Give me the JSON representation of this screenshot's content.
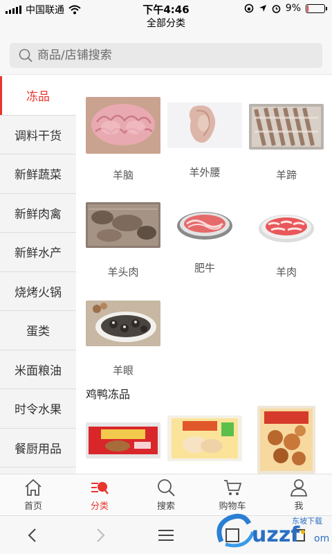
{
  "status": {
    "carrier": "中国联通",
    "time": "下午4:46",
    "battery": "9%",
    "battery_level": 0.09
  },
  "page": {
    "title": "全部分类"
  },
  "search": {
    "placeholder": "商品/店铺搜索"
  },
  "sidebar": {
    "items": [
      {
        "label": "冻品",
        "active": true
      },
      {
        "label": "调料干货"
      },
      {
        "label": "新鲜蔬菜"
      },
      {
        "label": "新鲜肉禽"
      },
      {
        "label": "新鲜水产"
      },
      {
        "label": "烧烤火锅"
      },
      {
        "label": "蛋类"
      },
      {
        "label": "米面粮油"
      },
      {
        "label": "时令水果"
      },
      {
        "label": "餐厨用品"
      }
    ]
  },
  "products": [
    {
      "name": "羊脑",
      "icon": "lamb-brain-photo"
    },
    {
      "name": "羊外腰",
      "icon": "lamb-kidney-photo"
    },
    {
      "name": "羊蹄",
      "icon": "lamb-trotter-photo"
    },
    {
      "name": "羊头肉",
      "icon": "lamb-head-meat-photo"
    },
    {
      "name": "肥牛",
      "icon": "fat-beef-photo"
    },
    {
      "name": "羊肉",
      "icon": "lamb-roll-photo"
    },
    {
      "name": "羊眼",
      "icon": "lamb-eye-photo"
    }
  ],
  "section2": {
    "title": "鸡鸭冻品",
    "items": [
      {
        "icon": "chicken-pack-photo"
      },
      {
        "icon": "dumpling-pack-photo"
      },
      {
        "icon": "duck-pack-photo"
      }
    ]
  },
  "tabbar": {
    "items": [
      {
        "label": "首页",
        "icon": "home-icon"
      },
      {
        "label": "分类",
        "icon": "category-icon",
        "active": true
      },
      {
        "label": "搜索",
        "icon": "search-icon"
      },
      {
        "label": "购物车",
        "icon": "cart-icon"
      },
      {
        "label": "我",
        "icon": "user-icon"
      }
    ]
  },
  "colors": {
    "accent": "#e8352e",
    "sidebar_bg": "#f4f4f4"
  }
}
